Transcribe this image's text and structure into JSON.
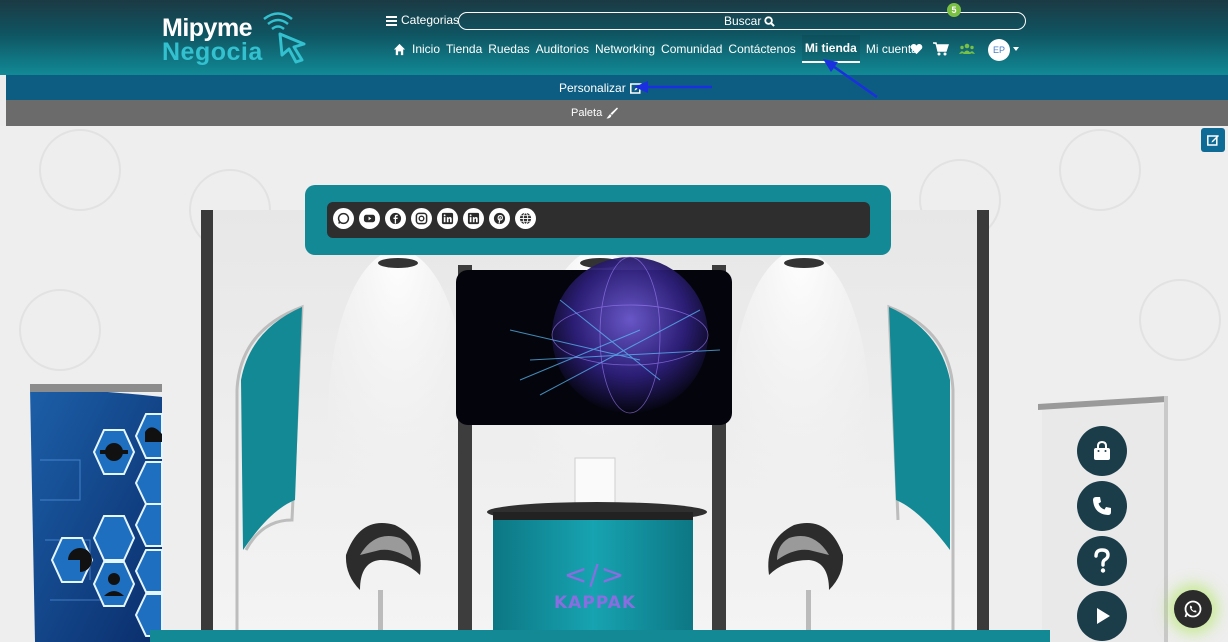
{
  "brand": {
    "line1": "Mipyme",
    "line2": "Negocia"
  },
  "header": {
    "categories_label": "Categorias",
    "search_label": "Buscar",
    "nav": [
      "Inicio",
      "Tienda",
      "Ruedas",
      "Auditorios",
      "Networking",
      "Comunidad",
      "Contáctenos",
      "Mi tienda",
      "Mi cuenta"
    ],
    "active_nav": "Mi tienda",
    "notification_count": "5",
    "avatar_initials": "EP"
  },
  "toolbar": {
    "personalizar_label": "Personalizar",
    "paleta_label": "Paleta"
  },
  "booth": {
    "social_icons": [
      "whatsapp-icon",
      "youtube-icon",
      "facebook-icon",
      "instagram-icon",
      "linkedin-icon",
      "linkedin-icon",
      "pinterest-icon",
      "globe-icon"
    ],
    "counter_brand": "KAPPAK",
    "counter_symbol": "</>"
  },
  "colors": {
    "teal": "#118a96",
    "dark_header": "#1b3a44",
    "blue_bar": "#0d5d82",
    "gray_bar": "#6b6b6b",
    "accent_green": "#7ac143"
  }
}
